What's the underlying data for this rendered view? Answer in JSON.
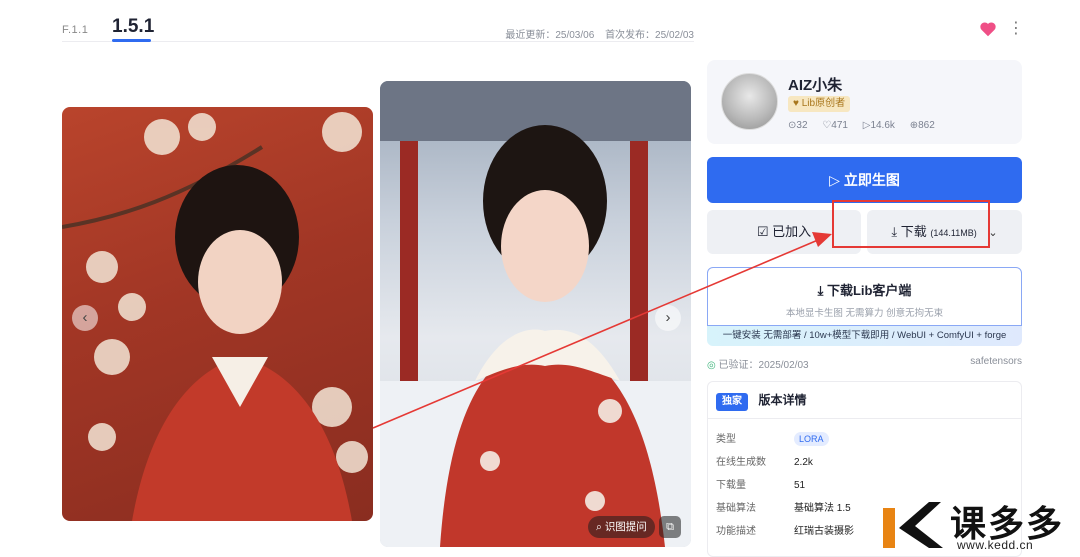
{
  "version_tabs": {
    "previous": "F.1.1",
    "current": "1.5.1"
  },
  "dates": {
    "updated": "最近更新：25/03/06",
    "published": "首次发布：25/02/03"
  },
  "header_icons": {
    "like": "heart-icon",
    "more": "more-vertical-icon",
    "accent": "#ef4f86"
  },
  "gallery": {
    "prev_arrow": "‹",
    "next_arrow": "›",
    "overlay_action": "识图提问",
    "overlay_icon": "image-edit-icon"
  },
  "author": {
    "name": "AIZ小朱",
    "badge": "Lib原创者",
    "stats": {
      "followers": "32",
      "likes": "471",
      "runs": "14.6k",
      "downloads": "862"
    }
  },
  "actions": {
    "generate": "立即生图",
    "added": "已加入",
    "download": "下载",
    "download_size": "(144.11MB)",
    "primary_color": "#2f6bf0"
  },
  "client": {
    "title": "下载Lib客户端",
    "subtitle": "本地显卡生图 无需算力 创意无拘无束",
    "promo": "一键安装 无需部署 / 10w+模型下载即用 / WebUI + ComfyUI + forge"
  },
  "verification": {
    "label": "已验证：2025/02/03",
    "format": "safetensors"
  },
  "details": {
    "tag": "独家",
    "title": "版本详情",
    "rows": [
      {
        "key": "类型",
        "value": "LORA"
      },
      {
        "key": "在线生成数",
        "value": "2.2k"
      },
      {
        "key": "下载量",
        "value": "51"
      },
      {
        "key": "基础算法",
        "value": "基础算法 1.5"
      },
      {
        "key": "功能描述",
        "value": "红瑞古装摄影"
      }
    ]
  },
  "annotation": {
    "color": "#e53935"
  },
  "watermark": {
    "text": "课多多",
    "url": "www.kedd.cn"
  }
}
